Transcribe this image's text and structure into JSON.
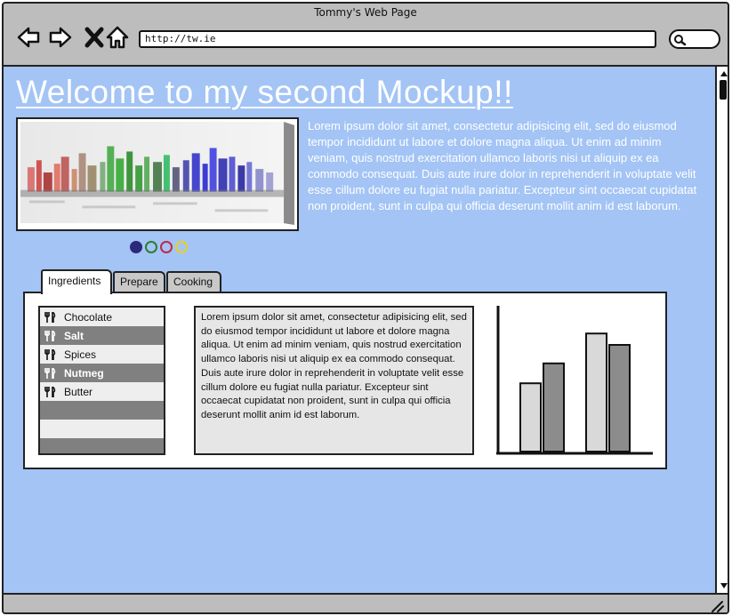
{
  "window": {
    "title": "Tommy's Web Page"
  },
  "browser": {
    "url": "http://tw.ie"
  },
  "page": {
    "heading": "Welcome to my second Mockup!!",
    "intro": "Lorem ipsum dolor sit amet, consectetur adipisicing elit, sed do eiusmod tempor incididunt ut labore et dolore magna aliqua. Ut enim ad minim veniam, quis nostrud exercitation ullamco laboris nisi ut aliquip ex ea commodo consequat. Duis aute irure dolor in reprehenderit in voluptate velit esse cillum dolore eu fugiat nulla pariatur. Excepteur sint occaecat cupidatat non proident, sunt in culpa qui officia deserunt mollit anim id est laborum.",
    "carousel_dots": [
      {
        "color": "#2b2a7a",
        "filled": true
      },
      {
        "color": "#2e7d2e",
        "filled": false
      },
      {
        "color": "#c0284a",
        "filled": false
      },
      {
        "color": "#e6d21e",
        "filled": false
      }
    ]
  },
  "tabs": [
    {
      "label": "Ingredients",
      "active": true
    },
    {
      "label": "Prepare",
      "active": false
    },
    {
      "label": "Cooking",
      "active": false
    }
  ],
  "ingredients": {
    "icon": "fork-knife-icon",
    "items": [
      "Chocolate",
      "Salt",
      "Spices",
      "Nutmeg",
      "Butter"
    ]
  },
  "panel_text": "Lorem ipsum dolor sit amet, consectetur adipisicing elit, sed do eiusmod tempor incididunt ut labore et dolore magna aliqua. Ut enim ad minim veniam, quis nostrud exercitation ullamco laboris nisi ut aliquip ex ea commodo consequat. Duis aute irure dolor in reprehenderit in voluptate velit esse cillum dolore eu fugiat nulla pariatur. Excepteur sint occaecat cupidatat non proident, sunt in culpa qui officia deserunt mollit anim id est laborum.",
  "chart_data": {
    "type": "bar",
    "series": [
      {
        "values": [
          48,
          83
        ]
      },
      {
        "values": [
          62,
          75
        ]
      }
    ],
    "ylim": [
      0,
      100
    ],
    "colors": [
      "#d9d9d9",
      "#8c8c8c"
    ]
  },
  "colors": {
    "page_background": "#a3c4f5",
    "chrome": "#bdbdbd",
    "text_on_page": "#ffffff"
  }
}
